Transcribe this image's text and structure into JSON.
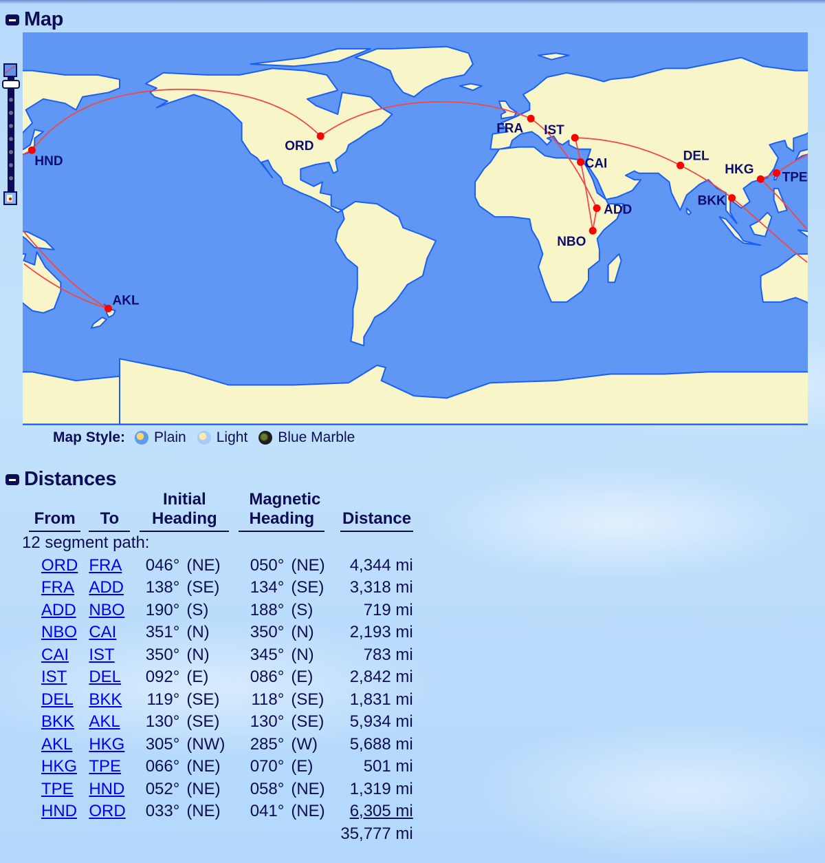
{
  "sections": {
    "map_title": "Map",
    "distances_title": "Distances"
  },
  "map": {
    "colors": {
      "ocean": "#6097f4",
      "land": "#f8f6c8",
      "coast": "#1a5ff5",
      "border": "#9a9a22",
      "route": "#f04848",
      "airport": "#ff0000"
    },
    "airports": [
      {
        "code": "ORD",
        "lat": 41.98,
        "lon": -87.9
      },
      {
        "code": "FRA",
        "lat": 50.03,
        "lon": 8.57
      },
      {
        "code": "ADD",
        "lat": 8.98,
        "lon": 38.8
      },
      {
        "code": "NBO",
        "lat": -1.32,
        "lon": 36.93
      },
      {
        "code": "CAI",
        "lat": 30.12,
        "lon": 31.41
      },
      {
        "code": "IST",
        "lat": 41.26,
        "lon": 28.74
      },
      {
        "code": "DEL",
        "lat": 28.57,
        "lon": 77.1
      },
      {
        "code": "BKK",
        "lat": 13.69,
        "lon": 100.75
      },
      {
        "code": "AKL",
        "lat": -37.01,
        "lon": 174.79
      },
      {
        "code": "HKG",
        "lat": 22.31,
        "lon": 113.91
      },
      {
        "code": "TPE",
        "lat": 25.08,
        "lon": 121.23
      },
      {
        "code": "HND",
        "lat": 35.55,
        "lon": 139.78
      }
    ],
    "style_label": "Map Style:",
    "styles": [
      {
        "name": "Plain",
        "icon": "plain-globe-icon"
      },
      {
        "name": "Light",
        "icon": "light-globe-icon"
      },
      {
        "name": "Blue Marble",
        "icon": "blue-marble-globe-icon"
      }
    ]
  },
  "distances": {
    "headers": {
      "from": "From",
      "to": "To",
      "initial_top": "Initial",
      "initial_bottom": "Heading",
      "magnetic_top": "Magnetic",
      "magnetic_bottom": "Heading",
      "distance": "Distance"
    },
    "segment_label": "12 segment path:",
    "rows": [
      {
        "from": "ORD",
        "to": "FRA",
        "init_deg": "046°",
        "init_dir": "(NE)",
        "mag_deg": "050°",
        "mag_dir": "(NE)",
        "distance": "4,344 mi"
      },
      {
        "from": "FRA",
        "to": "ADD",
        "init_deg": "138°",
        "init_dir": "(SE)",
        "mag_deg": "134°",
        "mag_dir": "(SE)",
        "distance": "3,318 mi"
      },
      {
        "from": "ADD",
        "to": "NBO",
        "init_deg": "190°",
        "init_dir": "(S)",
        "mag_deg": "188°",
        "mag_dir": "(S)",
        "distance": "719 mi"
      },
      {
        "from": "NBO",
        "to": "CAI",
        "init_deg": "351°",
        "init_dir": "(N)",
        "mag_deg": "350°",
        "mag_dir": "(N)",
        "distance": "2,193 mi"
      },
      {
        "from": "CAI",
        "to": "IST",
        "init_deg": "350°",
        "init_dir": "(N)",
        "mag_deg": "345°",
        "mag_dir": "(N)",
        "distance": "783 mi"
      },
      {
        "from": "IST",
        "to": "DEL",
        "init_deg": "092°",
        "init_dir": "(E)",
        "mag_deg": "086°",
        "mag_dir": "(E)",
        "distance": "2,842 mi"
      },
      {
        "from": "DEL",
        "to": "BKK",
        "init_deg": "119°",
        "init_dir": "(SE)",
        "mag_deg": "118°",
        "mag_dir": "(SE)",
        "distance": "1,831 mi"
      },
      {
        "from": "BKK",
        "to": "AKL",
        "init_deg": "130°",
        "init_dir": "(SE)",
        "mag_deg": "130°",
        "mag_dir": "(SE)",
        "distance": "5,934 mi"
      },
      {
        "from": "AKL",
        "to": "HKG",
        "init_deg": "305°",
        "init_dir": "(NW)",
        "mag_deg": "285°",
        "mag_dir": "(W)",
        "distance": "5,688 mi"
      },
      {
        "from": "HKG",
        "to": "TPE",
        "init_deg": "066°",
        "init_dir": "(NE)",
        "mag_deg": "070°",
        "mag_dir": "(E)",
        "distance": "501 mi"
      },
      {
        "from": "TPE",
        "to": "HND",
        "init_deg": "052°",
        "init_dir": "(NE)",
        "mag_deg": "058°",
        "mag_dir": "(NE)",
        "distance": "1,319 mi"
      },
      {
        "from": "HND",
        "to": "ORD",
        "init_deg": "033°",
        "init_dir": "(NE)",
        "mag_deg": "041°",
        "mag_dir": "(NE)",
        "distance": "6,305 mi"
      }
    ],
    "total": "35,777 mi"
  }
}
